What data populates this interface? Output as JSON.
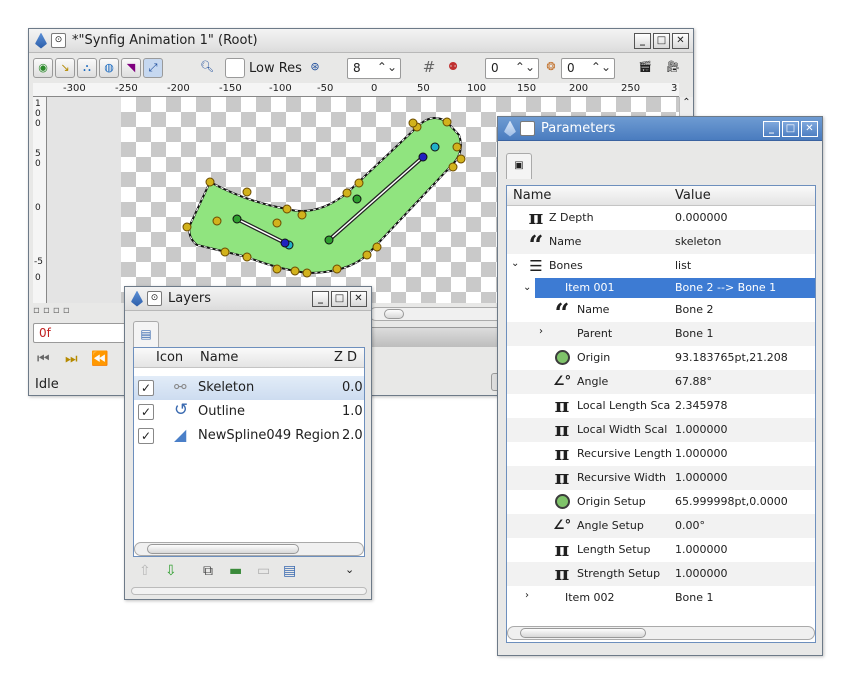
{
  "canvas_window": {
    "title": "*\"Synfig Animation 1\" (Root)",
    "toolbar": {
      "low_res_label": "Low Res",
      "pixel_size": "8",
      "onion_past": "0",
      "onion_future": "0"
    },
    "ruler_labels": [
      "-300",
      "-250",
      "-200",
      "-150",
      "-100",
      "-50",
      "0",
      "50",
      "100",
      "150",
      "200",
      "250",
      "3"
    ],
    "vruler_labels": [
      "1",
      "0",
      "0",
      "5",
      "0",
      "0",
      "-5",
      "0"
    ],
    "time_field": "0f",
    "status": "Idle"
  },
  "layers_window": {
    "title": "Layers",
    "columns": {
      "icon": "Icon",
      "name": "Name",
      "z": "Z D"
    },
    "layers": [
      {
        "name": "Skeleton",
        "z": "0.0",
        "checked": "✓",
        "icon": "bone-icon"
      },
      {
        "name": "Outline",
        "z": "1.0",
        "checked": "✓",
        "icon": "outline-icon"
      },
      {
        "name": "NewSpline049 Region",
        "z": "2.0",
        "checked": "✓",
        "icon": "region-icon"
      }
    ]
  },
  "params_window": {
    "title": "Parameters",
    "columns": {
      "name": "Name",
      "value": "Value"
    },
    "rows": [
      {
        "label": "Z Depth",
        "value": "0.000000",
        "icon": "pi-icon"
      },
      {
        "label": "Name",
        "value": "skeleton",
        "icon": "quote-icon"
      },
      {
        "label": "Bones",
        "value": "list",
        "icon": "list-icon"
      },
      {
        "label": "Item 001",
        "value": "Bone 2 --> Bone 1"
      },
      {
        "label": "Name",
        "value": "Bone 2",
        "icon": "quote-icon"
      },
      {
        "label": "Parent",
        "value": "Bone 1"
      },
      {
        "label": "Origin",
        "value": "93.183765pt,21.208",
        "icon": "point-icon"
      },
      {
        "label": "Angle",
        "value": "67.88°",
        "icon": "angle-icon"
      },
      {
        "label": "Local Length Sca",
        "value": "2.345978",
        "icon": "pi-icon"
      },
      {
        "label": "Local Width Scal",
        "value": "1.000000",
        "icon": "pi-icon"
      },
      {
        "label": "Recursive Length",
        "value": "1.000000",
        "icon": "pi-icon"
      },
      {
        "label": "Recursive Width",
        "value": "1.000000",
        "icon": "pi-icon"
      },
      {
        "label": "Origin Setup",
        "value": "65.999998pt,0.0000",
        "icon": "point-icon"
      },
      {
        "label": "Angle Setup",
        "value": "0.00°",
        "icon": "angle-icon"
      },
      {
        "label": "Length Setup",
        "value": "1.000000",
        "icon": "pi-icon"
      },
      {
        "label": "Strength Setup",
        "value": "1.000000",
        "icon": "pi-icon"
      },
      {
        "label": "Item 002",
        "value": "Bone 1"
      }
    ]
  },
  "colors": {
    "accent": "#3d7bd3",
    "shape_fill": "#90e47f",
    "handle_yellow": "#d2b21c",
    "handle_green": "#2f9e2f"
  }
}
